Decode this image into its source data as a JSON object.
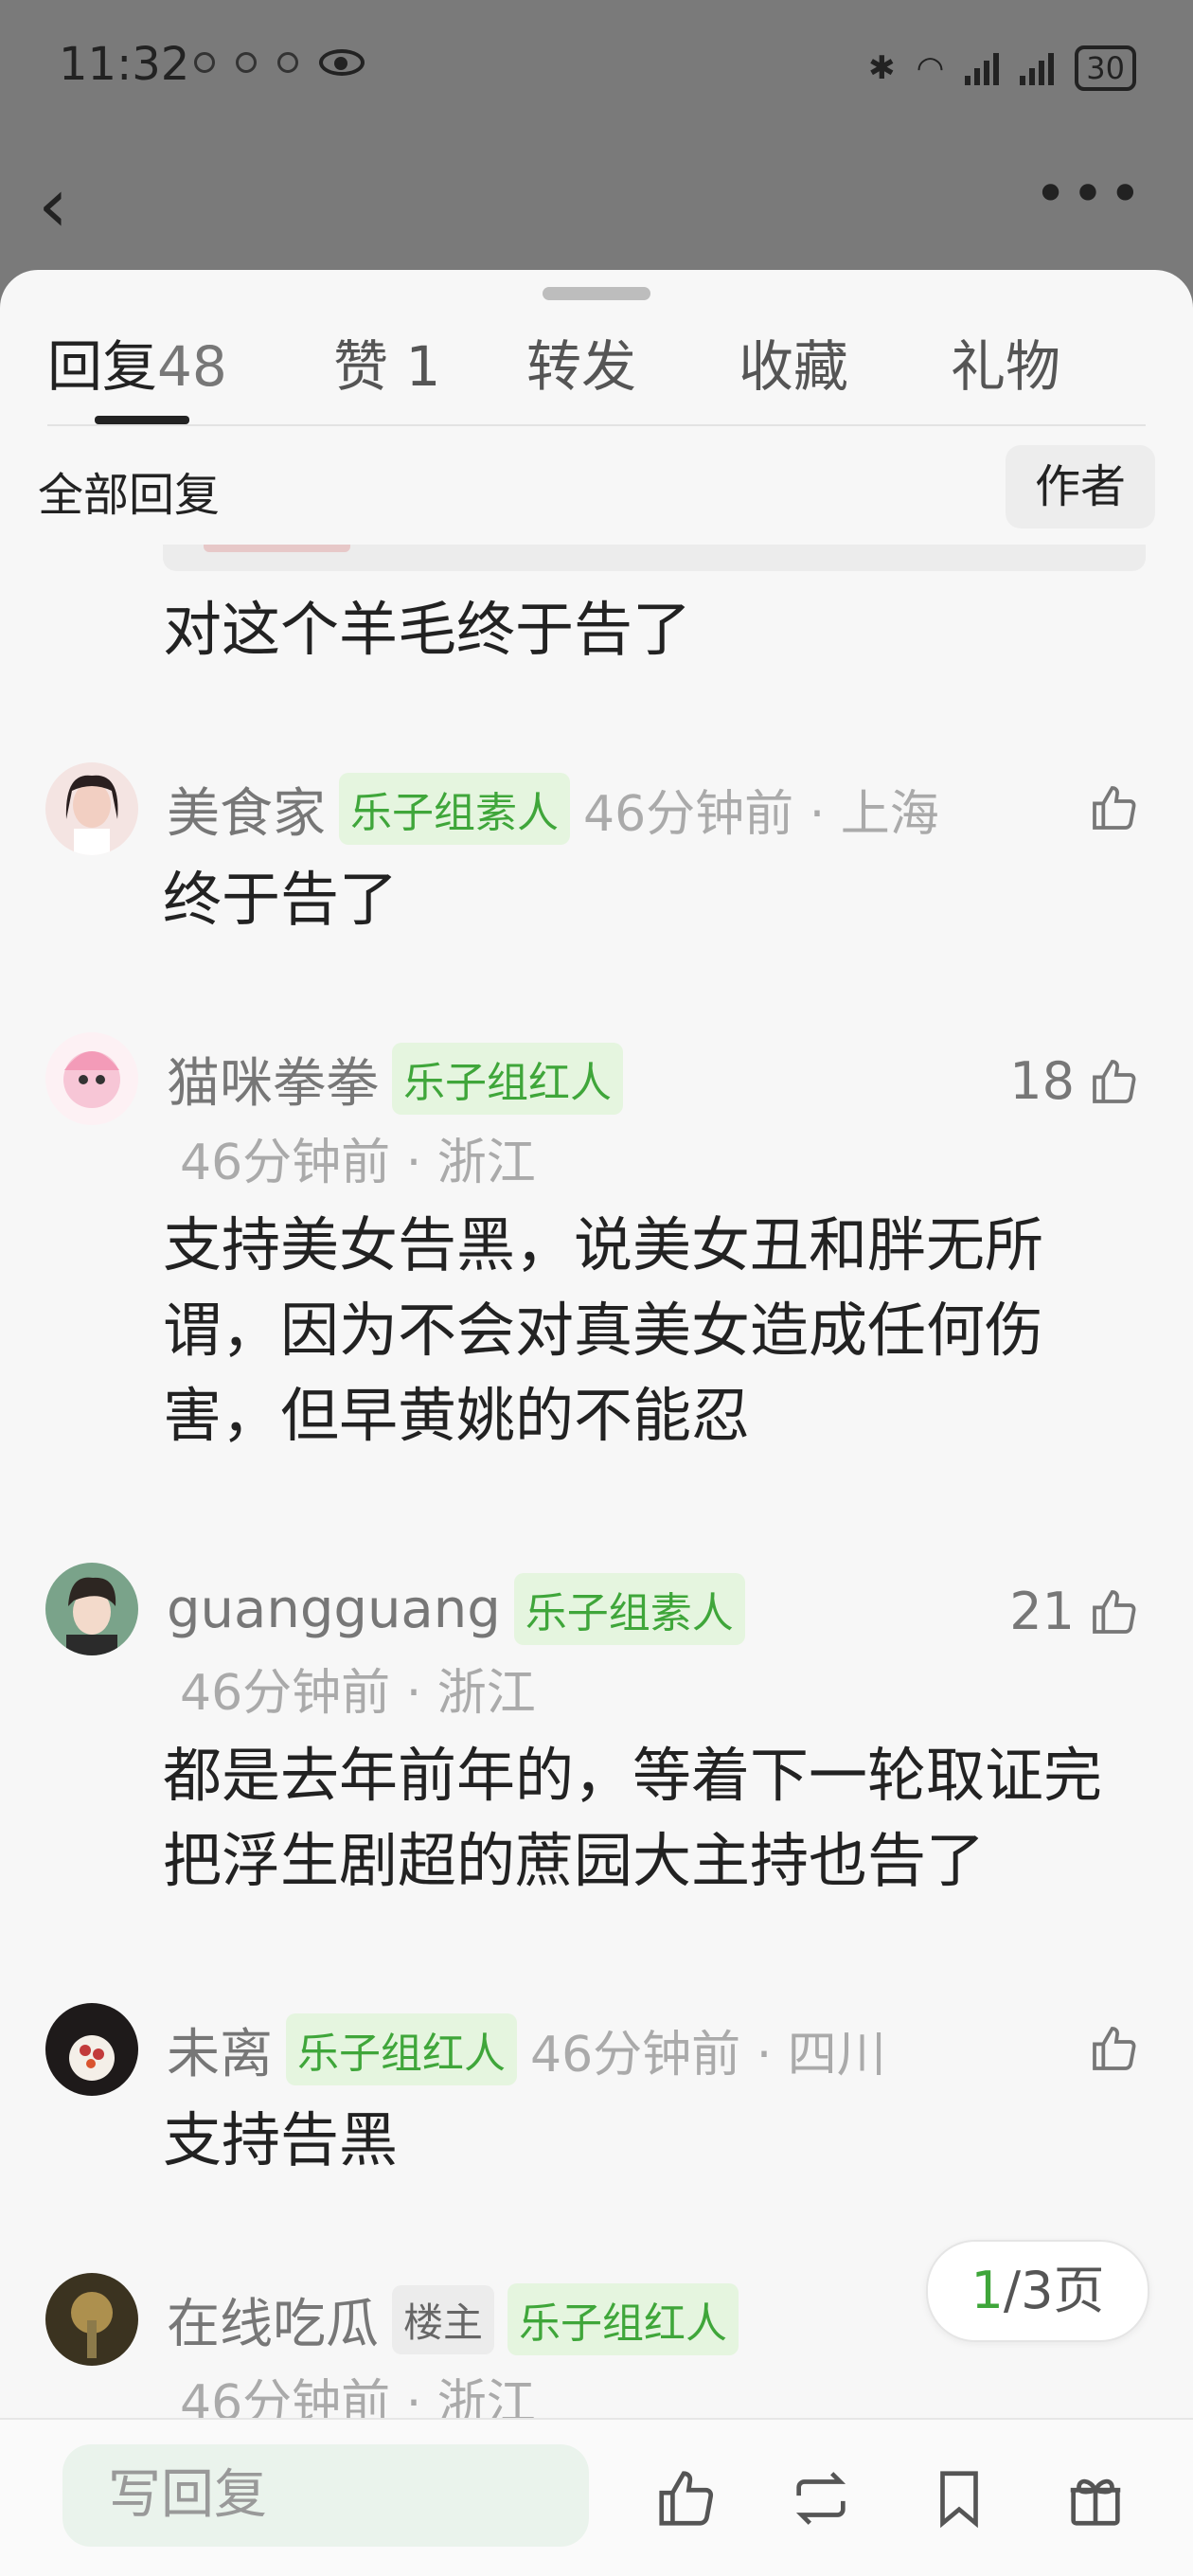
{
  "status_bar": {
    "time": "11:32",
    "battery": "30"
  },
  "tabs": [
    {
      "label": "回复",
      "count": "48"
    },
    {
      "label": "赞",
      "count": "1"
    },
    {
      "label": "转发",
      "count": ""
    },
    {
      "label": "收藏",
      "count": ""
    },
    {
      "label": "礼物",
      "count": ""
    }
  ],
  "filter": {
    "label": "全部回复",
    "author_button": "作者"
  },
  "top_partial_comment": {
    "text": "对这个羊毛终于告了"
  },
  "comments": [
    {
      "username": "美食家",
      "badge": "乐子组素人",
      "time_location": "46分钟前 · 上海",
      "likes": "",
      "text": "终于告了"
    },
    {
      "username": "猫咪拳拳",
      "badge": "乐子组红人",
      "time_location": "46分钟前 · 浙江",
      "likes": "18",
      "text": "支持美女告黑，说美女丑和胖无所谓，因为不会对真美女造成任何伤害，但早黄姚的不能忍"
    },
    {
      "username": "guangguang",
      "badge": "乐子组素人",
      "time_location": "46分钟前 · 浙江",
      "likes": "21",
      "text": "都是去年前年的，等着下一轮取证完把浮生剧超的蔗园大主持也告了"
    },
    {
      "username": "未离",
      "badge": "乐子组红人",
      "time_location": "46分钟前 · 四川",
      "likes": "",
      "text": "支持告黑"
    },
    {
      "username": "在线吃瓜",
      "op_badge": "楼主",
      "badge": "乐子组红人",
      "time_location": "46分钟前 · 浙江",
      "likes": "",
      "text": ""
    }
  ],
  "pager": {
    "current": "1",
    "total_text": "/3页"
  },
  "bottom_bar": {
    "reply_placeholder": "写回复"
  },
  "icons": [
    "back-icon",
    "more-icon",
    "like-icon",
    "repost-icon",
    "bookmark-icon",
    "gift-icon"
  ],
  "colors": {
    "accent_green": "#3fa63a",
    "badge_bg": "#e5f5df"
  }
}
